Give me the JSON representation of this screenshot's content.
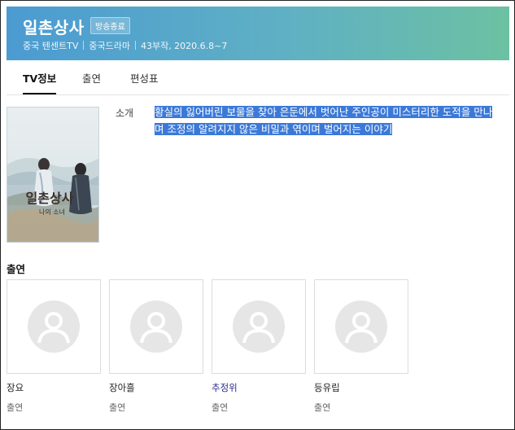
{
  "header": {
    "title": "일촌상사",
    "badge": "방송종료",
    "meta": [
      "중국 텐센트TV",
      "중국드라마",
      "43부작, 2020.6.8~7"
    ],
    "colors": {
      "gradient_start": "#4b9bd2",
      "gradient_end": "#6cc1a2"
    }
  },
  "tabs": [
    {
      "label": "TV정보",
      "active": true
    },
    {
      "label": "출연",
      "active": false
    },
    {
      "label": "편성표",
      "active": false
    }
  ],
  "poster": {
    "title_text": "일촌상사",
    "subtitle_text": "나의 소녀"
  },
  "intro": {
    "label": "소개",
    "text": "황실의 잃어버린 보물을 찾아 은둔에서 벗어난 주인공이 미스터리한 도적을 만나며 조정의 알려지지 않은 비밀과 엮이며 벌어지는 이야기",
    "highlight_color": "#3b79d8"
  },
  "cast": {
    "heading": "출연",
    "members": [
      {
        "name": "장요",
        "role": "출연"
      },
      {
        "name": "장아흘",
        "role": "출연"
      },
      {
        "name": "추정위",
        "role": "출연"
      },
      {
        "name": "등유립",
        "role": "출연"
      }
    ]
  }
}
